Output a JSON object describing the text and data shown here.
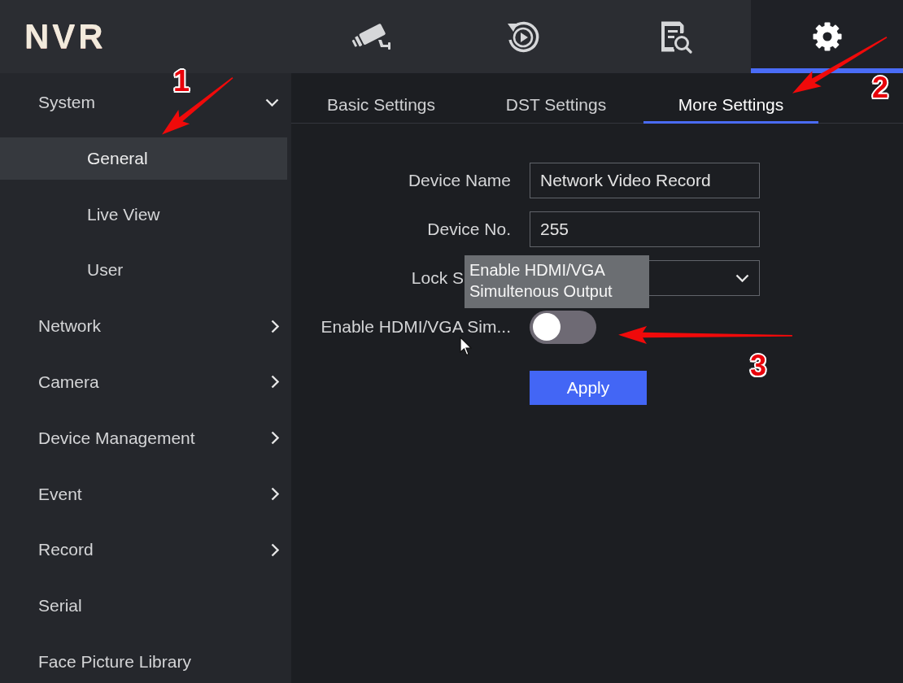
{
  "logo": {
    "text": "NVR"
  },
  "top_nav": [
    {
      "kind": "camera",
      "selected": false
    },
    {
      "kind": "playback",
      "selected": false
    },
    {
      "kind": "search",
      "selected": false
    },
    {
      "kind": "settings",
      "selected": true
    }
  ],
  "sidebar": {
    "items": [
      {
        "label": "System",
        "kind": "group",
        "expanded": true,
        "selected": false,
        "children": [
          {
            "label": "General",
            "selected": true
          },
          {
            "label": "Live View",
            "selected": false
          },
          {
            "label": "User",
            "selected": false
          }
        ]
      },
      {
        "label": "Network",
        "kind": "group",
        "expanded": false,
        "selected": false
      },
      {
        "label": "Camera",
        "kind": "group",
        "expanded": false,
        "selected": false
      },
      {
        "label": "Device Management",
        "kind": "group",
        "expanded": false,
        "selected": false
      },
      {
        "label": "Event",
        "kind": "group",
        "expanded": false,
        "selected": false
      },
      {
        "label": "Record",
        "kind": "group",
        "expanded": false,
        "selected": false
      },
      {
        "label": "Serial",
        "kind": "link",
        "selected": false
      },
      {
        "label": "Face Picture Library",
        "kind": "link",
        "selected": false
      }
    ]
  },
  "tabs": [
    {
      "label": "Basic Settings",
      "selected": false
    },
    {
      "label": "DST Settings",
      "selected": false
    },
    {
      "label": "More Settings",
      "selected": true
    }
  ],
  "form": {
    "fields": [
      {
        "kind": "text",
        "label": "Device Name",
        "value": "Network Video Record"
      },
      {
        "kind": "text",
        "label": "Device No.",
        "value": "255"
      },
      {
        "kind": "select",
        "label": "Lock S"
      },
      {
        "kind": "toggle",
        "label": "Enable HDMI/VGA Sim...",
        "on": false
      }
    ]
  },
  "tooltip": {
    "text": "Enable HDMI/VGA\nSimultenous Output"
  },
  "apply_button": {
    "label": "Apply"
  },
  "annotations": [
    {
      "number": "1"
    },
    {
      "number": "2"
    },
    {
      "number": "3"
    }
  ]
}
